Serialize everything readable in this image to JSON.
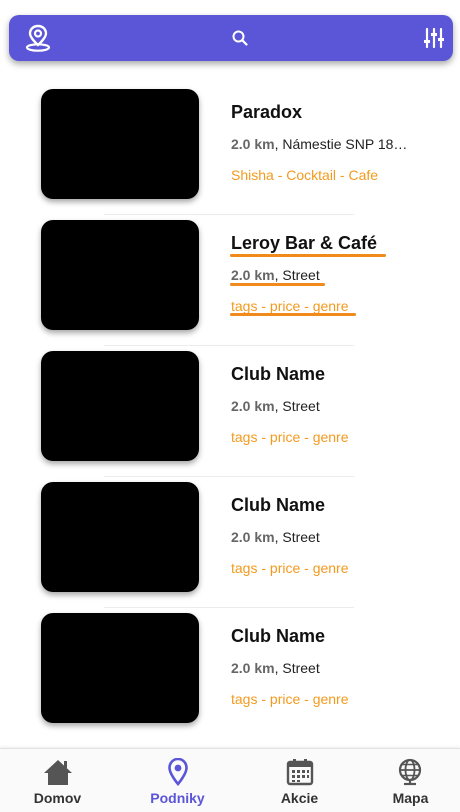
{
  "topbar": {
    "left_icon": "location-person-icon",
    "center_icon": "search-icon",
    "right_icon": "filter-sliders-icon",
    "color": "#5b55d8"
  },
  "venues": [
    {
      "name": "Paradox",
      "distance": "2.0 km",
      "address": ", Námestie SNP 18…",
      "tags": "Shisha - Cocktail - Cafe"
    },
    {
      "name": "Leroy Bar & Café",
      "distance": "2.0 km",
      "address": ", Street",
      "tags": "tags - price - genre"
    },
    {
      "name": "Club Name",
      "distance": "2.0 km",
      "address": ", Street",
      "tags": "tags - price - genre"
    },
    {
      "name": "Club Name",
      "distance": "2.0 km",
      "address": ", Street",
      "tags": "tags - price - genre"
    },
    {
      "name": "Club Name",
      "distance": "2.0 km",
      "address": ", Street",
      "tags": "tags - price - genre"
    }
  ],
  "nav": {
    "items": [
      {
        "label": "Domov",
        "icon": "home-icon"
      },
      {
        "label": "Podniky",
        "icon": "map-pin-icon",
        "active": true
      },
      {
        "label": "Akcie",
        "icon": "calendar-icon"
      },
      {
        "label": "Mapa",
        "icon": "globe-icon"
      }
    ],
    "active_color": "#5b55d8"
  },
  "colors": {
    "tags": "#f39a1e",
    "annotation_underline": "#f08a1c"
  }
}
